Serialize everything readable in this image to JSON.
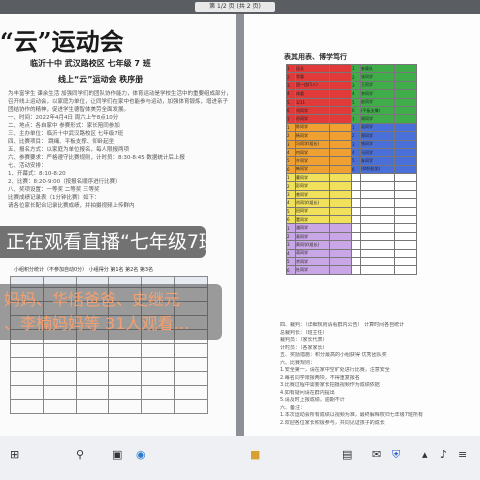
{
  "viewer": {
    "page_indicator": "第 1/2 页 (共 2 页)"
  },
  "left_page": {
    "title": "“云”运动会",
    "school_line": "临沂十中  武汉路校区  七年级 7 班",
    "booklet_line": "线上“云”运动会   秩序册",
    "paragraph": [
      "为丰富学生  课余生活  加强同学们的团队协作能力，体育运动是学校生活中的重要组成部分，七年级七班",
      "召开线上运动会，以家庭为单位，让同学们在家中也能参与运动，加强体育锻炼，增进亲子关系，培养学生",
      "团结协作的精神，促进学生德智体美劳全面发展。",
      "一、时间：2022年4月4日   周六上午8点10分",
      "二、地点：各自家中   参赛形式：家长陪同参加",
      "三、主办单位：临沂十中武汉路校区   七年级7班",
      "四、比赛项目：  跳绳、平板支撑、仰卧起坐",
      "五、报名方式：以家庭为单位报名，每人限报两项",
      "六、参赛要求：严格遵守比赛规则，计时员：8:30-8:45 数据统计后上报",
      "七、活动安排：",
      "   1、开幕式：8:10-8:20",
      "   2、比赛：8:20-9:00（按报名顺序进行比赛）",
      "八、奖项设置：一等奖 二等奖 三等奖",
      "   比赛成绩记录表（1分钟比赛）如下：",
      "   请各位家长配合记录比赛成绩，并拍摄视频上传群内"
    ],
    "record_table_header": "小组积分统计（不参加自动0分）  小组得分  第1名  第2名  第3名"
  },
  "overlays": {
    "live_banner": "正在观看直播“七年级7班",
    "viewers": [
      "妈妈、华恬爸爸、史继元",
      "、李楠妈妈等 31人观看…"
    ]
  },
  "right_page": {
    "header": "表其用表、博学笃行",
    "grid_rows": [
      {
        "n": "1",
        "name": "班长",
        "c": "#e03a3a",
        "n2": "1",
        "name2": "参赛队",
        "c2": "#3fae4a"
      },
      {
        "n": "2",
        "name": "学委",
        "c": "#e03a3a",
        "n2": "2",
        "name2": "张同学",
        "c2": "#3fae4a"
      },
      {
        "n": "3",
        "name": "团一组(5人)",
        "c": "#e03a3a",
        "n2": "3",
        "name2": "王同学",
        "c2": "#3fae4a"
      },
      {
        "n": "4",
        "name": "体委",
        "c": "#e03a3a",
        "n2": "4",
        "name2": "李同学",
        "c2": "#3fae4a"
      },
      {
        "n": "5",
        "name": "3/11",
        "c": "#e03a3a",
        "n2": "5",
        "name2": "赵同学",
        "c2": "#3fae4a"
      },
      {
        "n": "6",
        "name": "刘同学",
        "c": "#e03a3a",
        "n2": "6",
        "name2": "(平板支撑)",
        "c2": "#3fae4a"
      },
      {
        "n": "7",
        "name": "孙同学",
        "c": "#e03a3a",
        "n2": "7",
        "name2": "周同学",
        "c2": "#3fae4a"
      },
      {
        "n": "1",
        "name": "陈同学",
        "c": "#f0a030",
        "n2": "1",
        "name2": "吴同学",
        "c2": "#4a6fd8"
      },
      {
        "n": "2",
        "name": "杨同学",
        "c": "#f0a030",
        "n2": "2",
        "name2": "郑同学",
        "c2": "#4a6fd8"
      },
      {
        "n": "3",
        "name": "冯同学(组长)",
        "c": "#f0a030",
        "n2": "3",
        "name2": "钱同学",
        "c2": "#4a6fd8"
      },
      {
        "n": "4",
        "name": "何同学",
        "c": "#f0a030",
        "n2": "4",
        "name2": "马同学",
        "c2": "#4a6fd8"
      },
      {
        "n": "5",
        "name": "许同学",
        "c": "#f0a030",
        "n2": "5",
        "name2": "朱同学",
        "c2": "#4a6fd8"
      },
      {
        "n": "6",
        "name": "韩同学",
        "c": "#f0a030",
        "n2": "6",
        "name2": "(仰卧起坐)",
        "c2": "#4a6fd8"
      },
      {
        "n": "1",
        "name": "曹同学",
        "c": "#f1e05a",
        "n2": "",
        "name2": "",
        "c2": "#ffffff"
      },
      {
        "n": "2",
        "name": "彭同学",
        "c": "#f1e05a",
        "n2": "",
        "name2": "",
        "c2": "#ffffff"
      },
      {
        "n": "3",
        "name": "曾同学",
        "c": "#f1e05a",
        "n2": "",
        "name2": "",
        "c2": "#ffffff"
      },
      {
        "n": "4",
        "name": "肖同学(组长)",
        "c": "#f1e05a",
        "n2": "",
        "name2": "",
        "c2": "#ffffff"
      },
      {
        "n": "5",
        "name": "田同学",
        "c": "#f1e05a",
        "n2": "",
        "name2": "",
        "c2": "#ffffff"
      },
      {
        "n": "6",
        "name": "董同学",
        "c": "#f1e05a",
        "n2": "",
        "name2": "",
        "c2": "#ffffff"
      },
      {
        "n": "1",
        "name": "潘同学",
        "c": "#c9a6e6",
        "n2": "",
        "name2": "",
        "c2": "#ffffff"
      },
      {
        "n": "2",
        "name": "袁同学",
        "c": "#c9a6e6",
        "n2": "",
        "name2": "",
        "c2": "#ffffff"
      },
      {
        "n": "3",
        "name": "蔡同学(组长)",
        "c": "#c9a6e6",
        "n2": "",
        "name2": "",
        "c2": "#ffffff"
      },
      {
        "n": "4",
        "name": "蒋同学",
        "c": "#c9a6e6",
        "n2": "",
        "name2": "",
        "c2": "#ffffff"
      },
      {
        "n": "5",
        "name": "余同学",
        "c": "#c9a6e6",
        "n2": "",
        "name2": "",
        "c2": "#ffffff"
      },
      {
        "n": "6",
        "name": "杜同学",
        "c": "#c9a6e6",
        "n2": "",
        "name2": "",
        "c2": "#ffffff"
      }
    ],
    "text_lines": [
      "四、裁判：（详细规则请看群内公告）  计算时间各自统计",
      "    总裁判长：（班主任）",
      "    裁判员：（家长代表）",
      "    计时员：（各家家长）",
      "五、奖励措施：积分最高的小组获得  优秀团队奖",
      "六、比赛规则：",
      "   1.安全第一，请在家中空旷处进行比赛，注意安全",
      "   2.每名同学限报两项，不得重复报名",
      "   3.比赛过程中需要家长拍摄视频作为成绩依据",
      "   4.如有疑问请在群内提出",
      "   5.请及时上报成绩，逾期不计",
      "六、备注：",
      "   1.本次运动会所有成绩以视频为准，最终解释权归七年级7班所有",
      "   2.欢迎各位家长积极参与，共同见证孩子的成长"
    ]
  },
  "taskbar": {
    "icons": [
      "windows-icon",
      "search-icon",
      "taskview-icon",
      "edge-icon",
      "folder-icon",
      "store-icon",
      "mail-icon",
      "shield-icon",
      "tray-icon",
      "volume-icon",
      "network-icon"
    ]
  }
}
